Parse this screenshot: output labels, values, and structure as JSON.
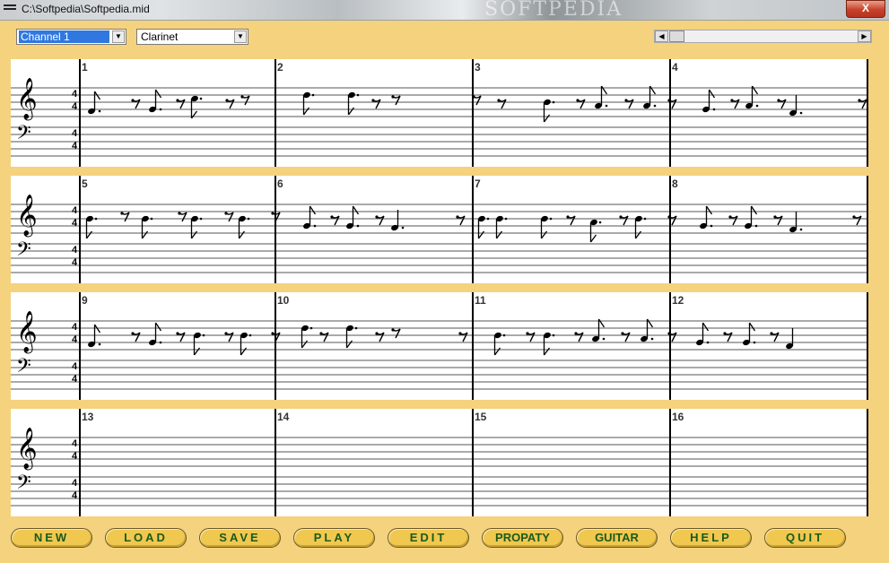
{
  "window": {
    "title": "C:\\Softpedia\\Softpedia.mid",
    "watermark": "SOFTPEDIA",
    "close_label": "X"
  },
  "controls": {
    "channel": "Channel 1",
    "instrument": "Clarinet"
  },
  "score": {
    "time_signature": {
      "top": "4",
      "bottom": "4"
    },
    "systems": [
      {
        "measures": [
          "1",
          "2",
          "3",
          "4"
        ]
      },
      {
        "measures": [
          "5",
          "6",
          "7",
          "8"
        ]
      },
      {
        "measures": [
          "9",
          "10",
          "11",
          "12"
        ]
      },
      {
        "measures": [
          "13",
          "14",
          "15",
          "16"
        ]
      }
    ]
  },
  "buttons": [
    "NEW",
    "LOAD",
    "SAVE",
    "PLAY",
    "EDIT",
    "PROPATY",
    "GUITAR",
    "HELP",
    "QUIT"
  ],
  "colors": {
    "background": "#f4d27e",
    "button_text": "#1b5a1b",
    "button_fill": "#f0c850"
  }
}
